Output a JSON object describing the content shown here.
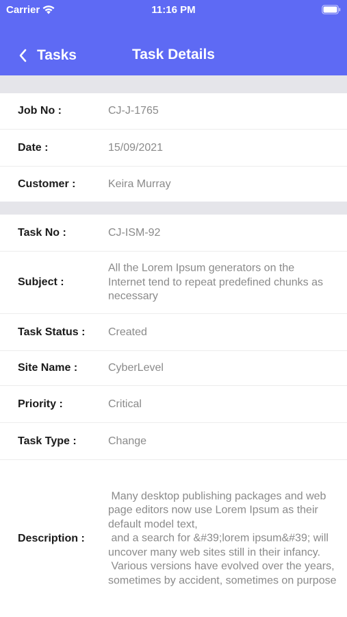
{
  "status_bar": {
    "carrier": "Carrier",
    "time": "11:16 PM",
    "wifi_icon": "wifi-icon",
    "battery_icon": "battery-icon"
  },
  "nav": {
    "back_label": "Tasks",
    "back_icon": "chevron-left-icon",
    "title": "Task Details"
  },
  "colors": {
    "header_background": "#5e6af4",
    "section_separator": "#e5e5ea",
    "label_text": "#1a1a1a",
    "value_text": "#8a8a8a"
  },
  "job_section": {
    "rows": [
      {
        "label": "Job No :",
        "value": "CJ-J-1765"
      },
      {
        "label": "Date :",
        "value": "15/09/2021"
      },
      {
        "label": "Customer :",
        "value": "Keira Murray"
      }
    ]
  },
  "task_section": {
    "rows": [
      {
        "label": "Task No :",
        "value": "CJ-ISM-92"
      },
      {
        "label": "Subject :",
        "value": "All the Lorem Ipsum generators on the Internet tend to repeat predefined chunks as necessary"
      },
      {
        "label": "Task Status :",
        "value": "Created"
      },
      {
        "label": "Site Name :",
        "value": "CyberLevel"
      },
      {
        "label": "Priority :",
        "value": "Critical"
      },
      {
        "label": "Task Type :",
        "value": "Change"
      },
      {
        "label": "Description :",
        "value": " Many desktop publishing packages and web page editors now use Lorem Ipsum as their default model text,\n and a search for &#39;lorem ipsum&#39; will uncover many web sites still in their infancy.\n Various versions have evolved over the years, sometimes by accident, sometimes on purpose"
      }
    ]
  }
}
